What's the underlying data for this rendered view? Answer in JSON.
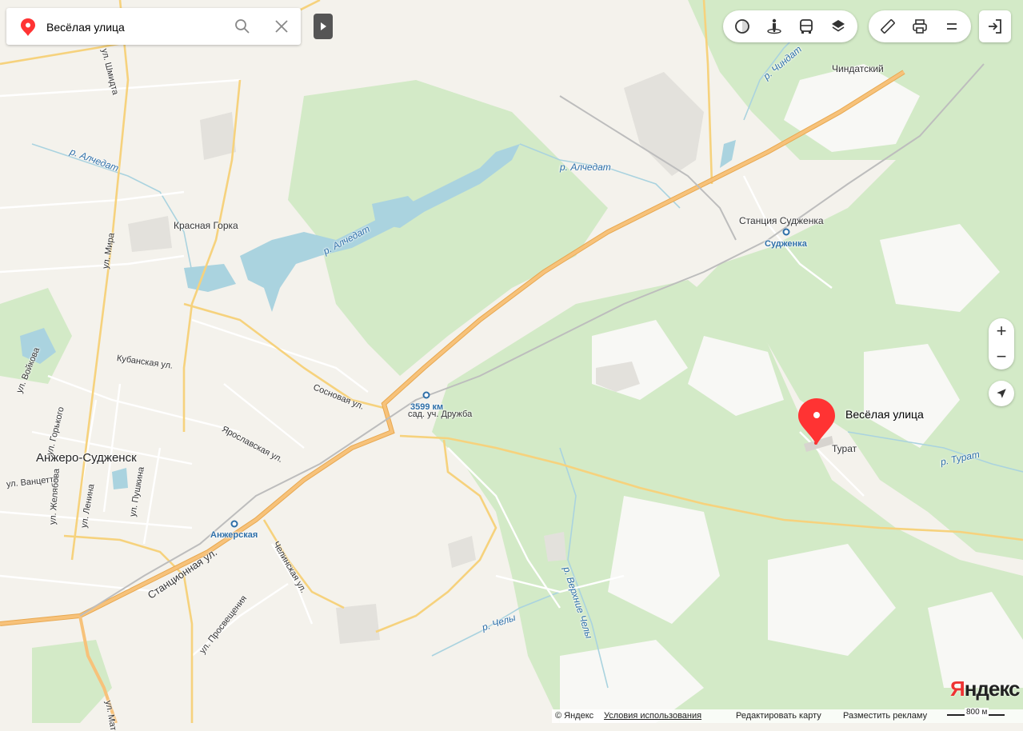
{
  "search": {
    "value": "Весёлая улица"
  },
  "toolbar": {
    "groups": [
      [
        "traffic-icon",
        "panorama-icon",
        "transport-icon",
        "layers-icon"
      ],
      [
        "ruler-icon",
        "print-icon",
        "menu-icon"
      ]
    ],
    "login_icon": "login-icon"
  },
  "zoom": {
    "plus": "+",
    "minus": "−"
  },
  "marker": {
    "label": "Весёлая улица",
    "color": "#ff3333"
  },
  "labels": {
    "alchedat1": "р. Алчедат",
    "alchedat2": "р. Алчедат",
    "alchedat3": "р. Алчедат",
    "chindat": "р. Чиндат",
    "chindatsky": "Чиндатский",
    "krasnaya_gorka": "Красная Горка",
    "stantsiya_sudzhenka": "Станция Судженка",
    "sudzhenka": "Судженка",
    "km3599": "3599 км",
    "druzhba": "сад. уч. Дружба",
    "turat": "Турат",
    "r_turat": "р. Турат",
    "anzhero": "Анжеро-Судженск",
    "anzherskaya": "Анжерская",
    "kubanskaya": "Кубанская ул.",
    "sosnovaya": "Сосновая ул.",
    "yaroslavskaya": "Ярославская ул.",
    "gorkogo": "ул. Горького",
    "voykova": "ул. Войкова",
    "mira": "ул. Мира",
    "shmidta": "ул. Шмидта",
    "vantsetti": "ул. Ванцетти",
    "zhelyabova": "ул. Желябова",
    "lenina": "ул. Ленина",
    "pushkina": "ул. Пушкина",
    "stantsionnaya": "Станционная ул.",
    "chelinskaya": "Челинская ул.",
    "prosvescheniya": "ул. Просвещения",
    "chely": "р. Челы",
    "verkhnie_chely": "р. Верхние Челы",
    "mat": "ул. Мат"
  },
  "footer": {
    "copyright": "© Яндекс",
    "terms": "Условия использования",
    "edit": "Редактировать карту",
    "ads": "Разместить рекламу"
  },
  "scale": {
    "label": "800 м"
  },
  "brand": {
    "first": "Я",
    "rest": "ндекс"
  },
  "colors": {
    "forest": "#cfe8c2",
    "water": "#aad3df",
    "highway": "#f7c27a",
    "land": "#f4f2ec"
  }
}
